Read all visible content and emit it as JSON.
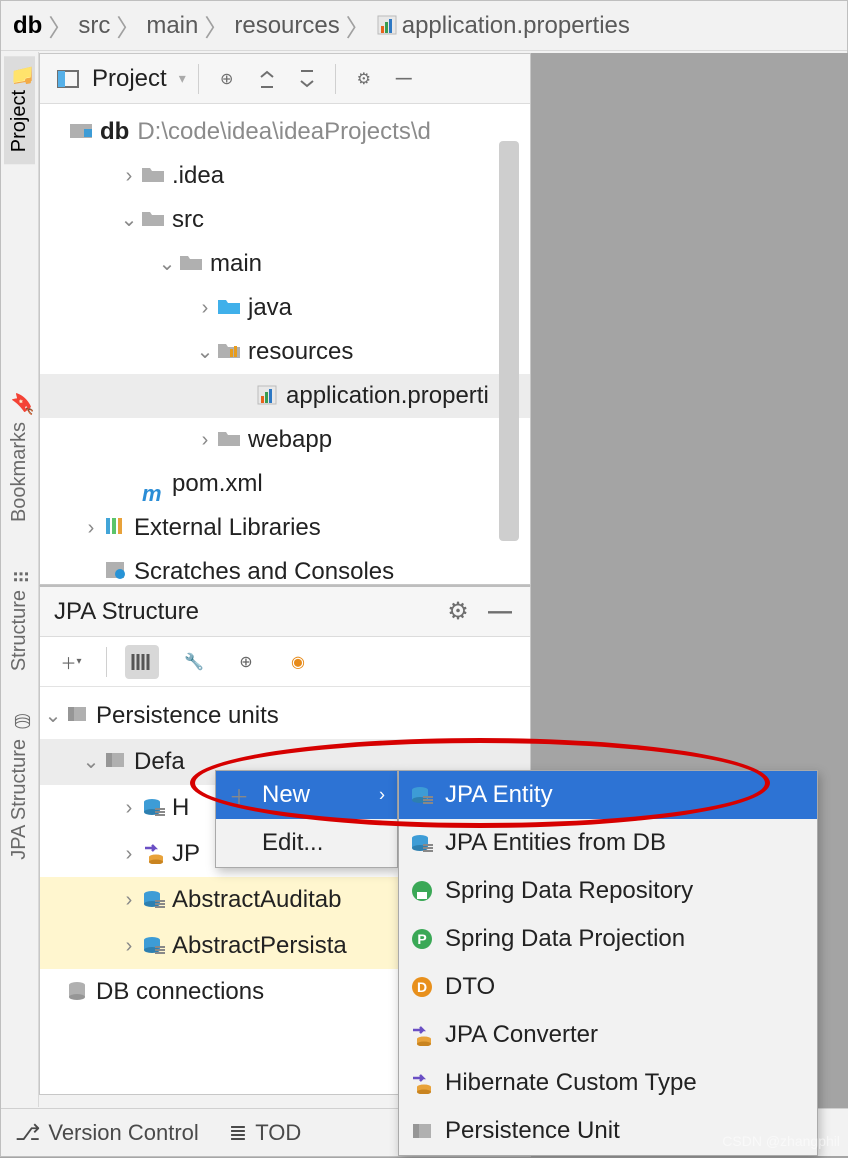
{
  "breadcrumb": [
    "db",
    "src",
    "main",
    "resources",
    "application.properties"
  ],
  "sidebar_tabs": {
    "project": "Project",
    "bookmarks": "Bookmarks",
    "structure": "Structure",
    "jpa": "JPA Structure"
  },
  "project_panel": {
    "title": "Project",
    "root": {
      "name": "db",
      "path": "D:\\code\\idea\\ideaProjects\\d"
    },
    "tree": [
      {
        "indent": 1,
        "caret": ">",
        "icon": "folder",
        "label": ".idea"
      },
      {
        "indent": 1,
        "caret": "v",
        "icon": "folder",
        "label": "src"
      },
      {
        "indent": 2,
        "caret": "v",
        "icon": "folder",
        "label": "main"
      },
      {
        "indent": 3,
        "caret": ">",
        "icon": "folder-java",
        "label": "java"
      },
      {
        "indent": 3,
        "caret": "v",
        "icon": "folder-res",
        "label": "resources"
      },
      {
        "indent": 4,
        "caret": " ",
        "icon": "props",
        "label": "application.properti",
        "selected": true
      },
      {
        "indent": 3,
        "caret": ">",
        "icon": "folder",
        "label": "webapp"
      },
      {
        "indent": 1,
        "caret": " ",
        "icon": "maven",
        "label": "pom.xml"
      },
      {
        "indent": 0,
        "caret": ">",
        "icon": "lib",
        "label": "External Libraries"
      },
      {
        "indent": 0,
        "caret": " ",
        "icon": "scratch",
        "label": "Scratches and Consoles"
      }
    ]
  },
  "jpa_panel": {
    "title": "JPA Structure",
    "tree": [
      {
        "indent": 0,
        "caret": "v",
        "icon": "punit",
        "label": "Persistence units"
      },
      {
        "indent": 1,
        "caret": "v",
        "icon": "punit",
        "label": "Defa",
        "selected": true
      },
      {
        "indent": 2,
        "caret": ">",
        "icon": "entity",
        "label": "H"
      },
      {
        "indent": 2,
        "caret": ">",
        "icon": "conv",
        "label": "JP"
      },
      {
        "indent": 2,
        "caret": ">",
        "icon": "entity",
        "label": "AbstractAuditab",
        "hl": true
      },
      {
        "indent": 2,
        "caret": ">",
        "icon": "entity",
        "label": "AbstractPersista",
        "hl": true
      },
      {
        "indent": 0,
        "caret": " ",
        "icon": "db",
        "label": "DB connections"
      }
    ]
  },
  "context_menu1": [
    {
      "label": "New",
      "submenu": true,
      "selected": true,
      "icon": "plus"
    },
    {
      "label": "Edit..."
    }
  ],
  "context_menu2": [
    {
      "label": "JPA Entity",
      "icon": "entity",
      "selected": true
    },
    {
      "label": "JPA Entities from DB",
      "icon": "entity"
    },
    {
      "label": "Spring Data Repository",
      "icon": "repo"
    },
    {
      "label": "Spring Data Projection",
      "icon": "proj"
    },
    {
      "label": "DTO",
      "icon": "dto"
    },
    {
      "label": "JPA Converter",
      "icon": "conv"
    },
    {
      "label": "Hibernate Custom Type",
      "icon": "conv"
    },
    {
      "label": "Persistence Unit",
      "icon": "punit"
    }
  ],
  "bottom_bar": {
    "version": "Version Control",
    "todo": "TOD"
  },
  "watermark": "CSDN @zhangphil"
}
